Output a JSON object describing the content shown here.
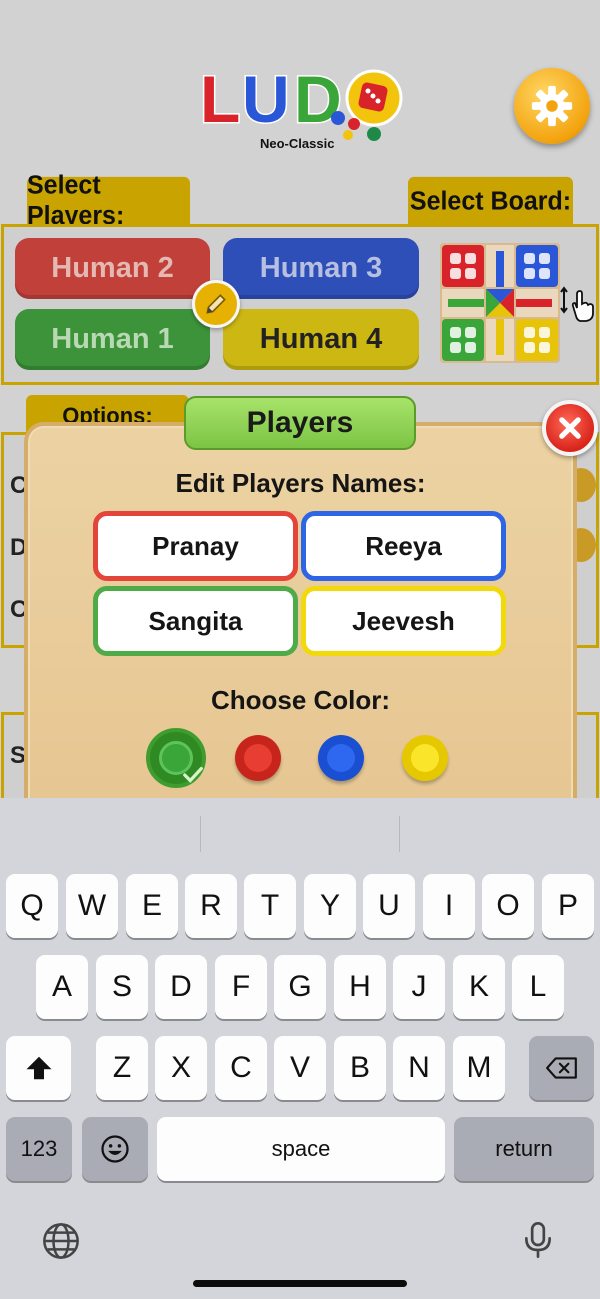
{
  "logo": {
    "text": "LUDO",
    "subtitle": "Neo-Classic"
  },
  "header": {
    "settings_icon": "gear-icon"
  },
  "select_players": {
    "label": "Select Players:",
    "buttons": [
      "Human 2",
      "Human 3",
      "Human 1",
      "Human 4"
    ],
    "edit_icon": "pencil-icon"
  },
  "select_board": {
    "label": "Select Board:"
  },
  "options": {
    "label": "Options:",
    "stubs": [
      "C",
      "D",
      "C",
      "S"
    ]
  },
  "modal": {
    "title": "Players",
    "close_icon": "close-icon",
    "edit_heading": "Edit Players Names:",
    "names": [
      "Pranay",
      "Reeya",
      "Sangita",
      "Jeevesh"
    ],
    "color_heading": "Choose Color:",
    "colors": [
      "#3aa539",
      "#e12b21",
      "#1e5ee6",
      "#f2d90c"
    ],
    "selected_color": "green"
  },
  "keyboard": {
    "row1": [
      "Q",
      "W",
      "E",
      "R",
      "T",
      "Y",
      "U",
      "I",
      "O",
      "P"
    ],
    "row2": [
      "A",
      "S",
      "D",
      "F",
      "G",
      "H",
      "J",
      "K",
      "L"
    ],
    "row3": [
      "Z",
      "X",
      "C",
      "V",
      "B",
      "N",
      "M"
    ],
    "numbers_key": "123",
    "emoji_icon": "emoji-icon",
    "space_key": "space",
    "return_key": "return",
    "shift_icon": "shift-icon",
    "delete_icon": "delete-icon",
    "globe_icon": "globe-icon",
    "mic_icon": "microphone-icon"
  }
}
